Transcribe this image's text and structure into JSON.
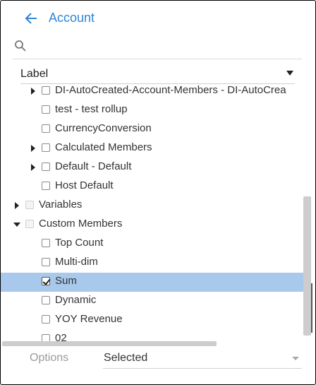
{
  "header": {
    "title": "Account",
    "back_icon": "back-arrow-icon",
    "accent": "#2f86d6"
  },
  "search": {
    "value": "",
    "placeholder": "",
    "icon": "search-icon"
  },
  "label_select": {
    "value": "Label"
  },
  "tree": {
    "rows": [
      {
        "label": "DI-AutoCreated-Account-Members - DI-AutoCrea",
        "expander": "collapsed",
        "checkbox": "unchecked",
        "selected": false,
        "level": 1
      },
      {
        "label": "test - test rollup",
        "expander": "none",
        "checkbox": "unchecked",
        "selected": false,
        "level": 1
      },
      {
        "label": "CurrencyConversion",
        "expander": "none",
        "checkbox": "unchecked",
        "selected": false,
        "level": 1
      },
      {
        "label": "Calculated Members",
        "expander": "collapsed",
        "checkbox": "unchecked",
        "selected": false,
        "level": 1
      },
      {
        "label": "Default - Default",
        "expander": "collapsed",
        "checkbox": "unchecked",
        "selected": false,
        "level": 1
      },
      {
        "label": "Host Default",
        "expander": "none",
        "checkbox": "unchecked",
        "selected": false,
        "level": 1
      },
      {
        "label": "Variables",
        "expander": "collapsed",
        "checkbox": "disabled",
        "selected": false,
        "level": 0
      },
      {
        "label": "Custom Members",
        "expander": "expanded",
        "checkbox": "disabled",
        "selected": false,
        "level": 0
      },
      {
        "label": "Top Count",
        "expander": "none",
        "checkbox": "unchecked",
        "selected": false,
        "level": 1
      },
      {
        "label": "Multi-dim",
        "expander": "none",
        "checkbox": "unchecked",
        "selected": false,
        "level": 1
      },
      {
        "label": "Sum",
        "expander": "none",
        "checkbox": "checked",
        "selected": true,
        "level": 1
      },
      {
        "label": "Dynamic",
        "expander": "none",
        "checkbox": "unchecked",
        "selected": false,
        "level": 1
      },
      {
        "label": "YOY Revenue",
        "expander": "none",
        "checkbox": "unchecked",
        "selected": false,
        "level": 1
      },
      {
        "label": "02",
        "expander": "none",
        "checkbox": "unchecked",
        "selected": false,
        "level": 1
      }
    ]
  },
  "footer": {
    "options_label": "Options",
    "options_value": "Selected"
  },
  "colors": {
    "selected_row": "#a8c8ec",
    "accent": "#2f86d6"
  }
}
